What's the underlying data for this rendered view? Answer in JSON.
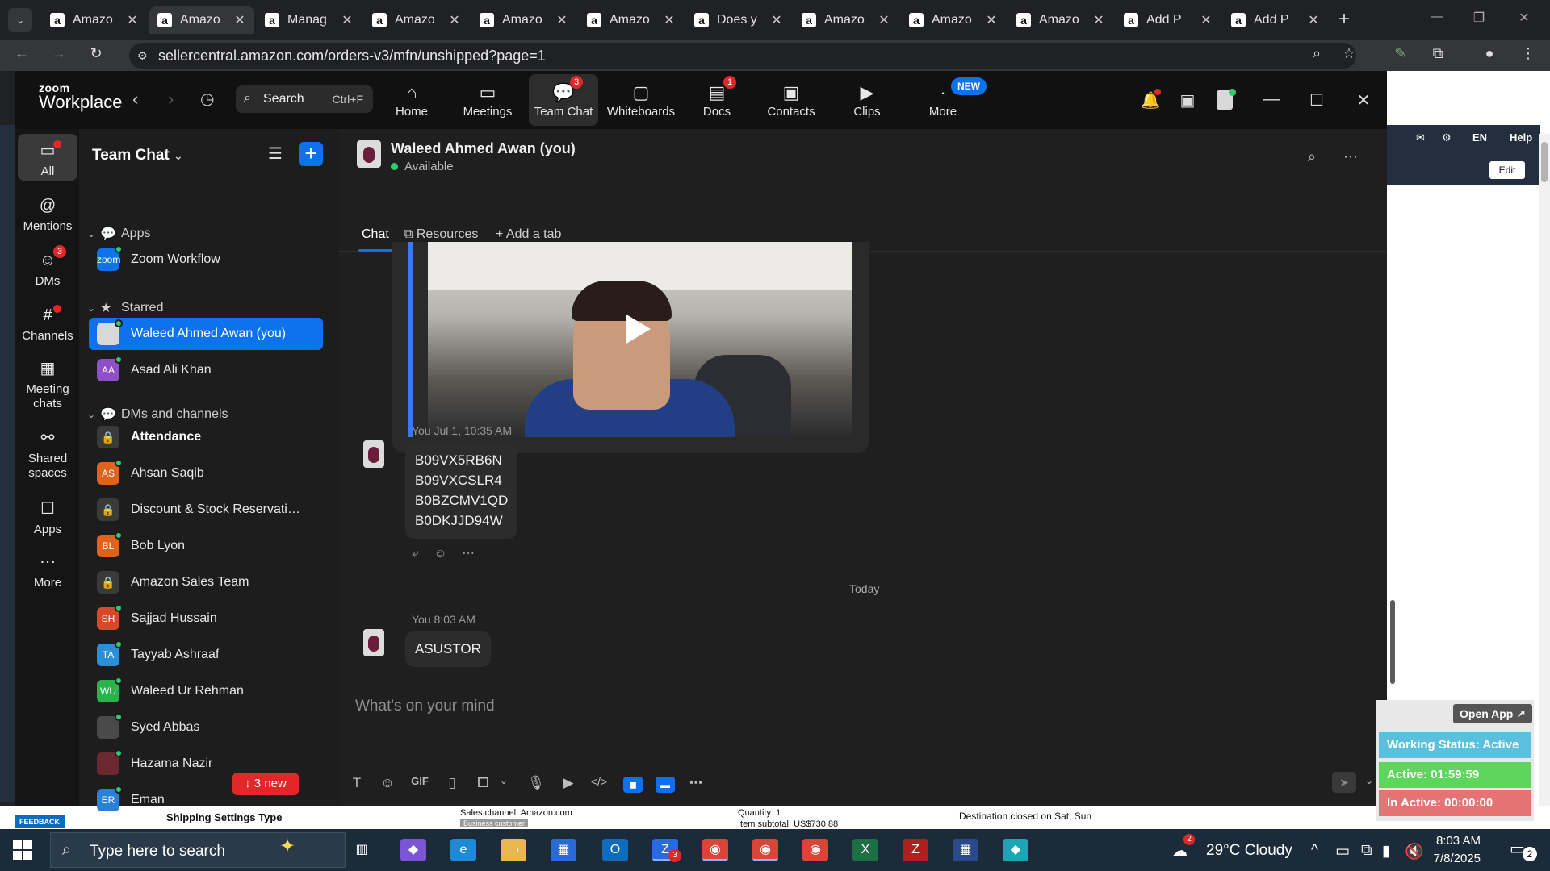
{
  "browser": {
    "tabs": [
      {
        "title": "Amazo"
      },
      {
        "title": "Amazo"
      },
      {
        "title": "Manag"
      },
      {
        "title": "Amazo"
      },
      {
        "title": "Amazo"
      },
      {
        "title": "Amazo"
      },
      {
        "title": "Does y"
      },
      {
        "title": "Amazo"
      },
      {
        "title": "Amazo"
      },
      {
        "title": "Amazo"
      },
      {
        "title": "Add P"
      },
      {
        "title": "Add P"
      }
    ],
    "active_tab": 1,
    "url": "sellercentral.amazon.com/orders-v3/mfn/unshipped?page=1"
  },
  "seller_central": {
    "top_links": {
      "lang": "EN",
      "help": "Help"
    },
    "edit": "Edit",
    "feedback": "FEEDBACK",
    "bottom": {
      "shipping_settings": "Shipping Settings Type",
      "sales_channel": "Sales channel: Amazon.com",
      "business_customer": "Business customer",
      "quantity": "Quantity: 1",
      "item_subtotal": "Item subtotal: US$730.88",
      "destination": "Destination closed on Sat, Sun"
    }
  },
  "zoom": {
    "logo_small": "zoom",
    "logo_big": "Workplace",
    "search": {
      "label": "Search",
      "shortcut": "Ctrl+F"
    },
    "nav": [
      {
        "label": "Home",
        "icon": "home-icon"
      },
      {
        "label": "Meetings",
        "icon": "video-camera-icon"
      },
      {
        "label": "Team Chat",
        "icon": "chat-icon",
        "badge": "3"
      },
      {
        "label": "Whiteboards",
        "icon": "whiteboard-icon"
      },
      {
        "label": "Docs",
        "icon": "docs-icon",
        "badge": "1"
      },
      {
        "label": "Contacts",
        "icon": "contacts-icon"
      },
      {
        "label": "Clips",
        "icon": "clips-icon"
      },
      {
        "label": "More",
        "icon": "more-icon",
        "new": "NEW"
      }
    ],
    "rail": [
      {
        "label": "All"
      },
      {
        "label": "Mentions"
      },
      {
        "label": "DMs",
        "badge": "3"
      },
      {
        "label": "Channels"
      },
      {
        "label": "Meeting chats"
      },
      {
        "label": "Shared spaces"
      },
      {
        "label": "Apps"
      },
      {
        "label": "More"
      }
    ],
    "list": {
      "title": "Team Chat",
      "sections": {
        "apps": "Apps",
        "starred": "Starred",
        "dms": "DMs and channels"
      },
      "apps": [
        {
          "name": "Zoom Workflow",
          "initials": "zoom",
          "color": "#0e72ed"
        }
      ],
      "starred": [
        {
          "name": "Waleed Ahmed Awan (you)",
          "initials": "",
          "color": "#d8d8d8"
        },
        {
          "name": "Asad Ali Khan",
          "initials": "AA",
          "color": "#8e4fc7"
        }
      ],
      "dms": [
        {
          "name": "Attendance",
          "initials": "",
          "color": "#3a3a3a",
          "lock": true,
          "bold": true
        },
        {
          "name": "Ahsan Saqib",
          "initials": "AS",
          "color": "#e0621f"
        },
        {
          "name": "Discount & Stock Reservatio...",
          "initials": "",
          "color": "#3a3a3a",
          "lock": true
        },
        {
          "name": "Bob Lyon",
          "initials": "BL",
          "color": "#e0621f"
        },
        {
          "name": "Amazon Sales Team",
          "initials": "",
          "color": "#3a3a3a",
          "lock": true
        },
        {
          "name": "Sajjad Hussain",
          "initials": "SH",
          "color": "#d9472b"
        },
        {
          "name": "Tayyab Ashraaf",
          "initials": "TA",
          "color": "#2a8fd6"
        },
        {
          "name": "Waleed Ur Rehman",
          "initials": "WU",
          "color": "#2ab34a"
        },
        {
          "name": "Syed Abbas",
          "initials": "",
          "color": "#4a4a4a"
        },
        {
          "name": "Hazama Nazir",
          "initials": "",
          "color": "#6b2a30"
        },
        {
          "name": "Eman",
          "initials": "ER",
          "color": "#2a7fd6"
        }
      ],
      "new_pill": "↓ 3 new"
    },
    "chat": {
      "name": "Waleed Ahmed Awan (you)",
      "status": "Available",
      "tabs": [
        "Chat",
        "Resources",
        "+ Add a tab"
      ],
      "messages": [
        {
          "meta": "You Jul 1, 10:35 AM",
          "lines": [
            "B09VX5RB6N",
            "B09VXCSLR4",
            "B0BZCMV1QD",
            "B0DKJJD94W"
          ]
        },
        {
          "meta": "You 8:03 AM",
          "lines": [
            "ASUSTOR"
          ]
        }
      ],
      "day_divider": "Today",
      "composer_placeholder": "What's on your mind"
    }
  },
  "working_status": {
    "open_app": "Open App ↗",
    "status": "Working Status: Active",
    "active": "Active: 01:59:59",
    "inactive": "In Active: 00:00:00",
    "colors": {
      "status": "#5bc0de",
      "active": "#5cd65c",
      "inactive": "#e57373"
    }
  },
  "taskbar": {
    "search_placeholder": "Type here to search",
    "weather": "29°C Cloudy",
    "weather_badge": "2",
    "time": "8:03 AM",
    "date": "7/8/2025",
    "notif_count": "2",
    "zoom_badge": "3"
  }
}
